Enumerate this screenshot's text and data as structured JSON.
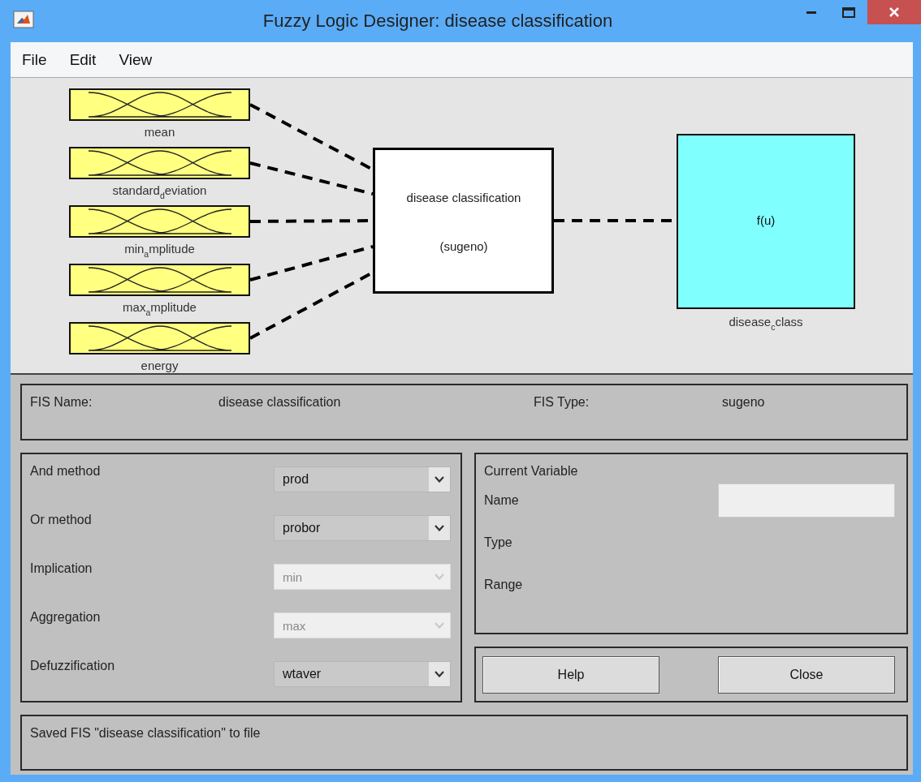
{
  "window": {
    "title": "Fuzzy Logic Designer: disease classification"
  },
  "menu": [
    "File",
    "Edit",
    "View"
  ],
  "diagram": {
    "inputs": [
      {
        "label": "mean"
      },
      {
        "label": "standard$_{d}$eviation"
      },
      {
        "label": "min$_{a}$mplitude"
      },
      {
        "label": "max$_{a}$mplitude"
      },
      {
        "label": "energy"
      }
    ],
    "rule_block": {
      "name": "disease classification",
      "type": "(sugeno)"
    },
    "output": {
      "function": "f(u)",
      "label": "disease$_{c}$class"
    }
  },
  "fis": {
    "name_label": "FIS Name:",
    "name": "disease classification",
    "type_label": "FIS Type:",
    "type": "sugeno"
  },
  "methods": [
    {
      "label": "And method",
      "value": "prod",
      "disabled": false
    },
    {
      "label": "Or method",
      "value": "probor",
      "disabled": false
    },
    {
      "label": "Implication",
      "value": "min",
      "disabled": true
    },
    {
      "label": "Aggregation",
      "value": "max",
      "disabled": true
    },
    {
      "label": "Defuzzification",
      "value": "wtaver",
      "disabled": false
    }
  ],
  "current_variable": {
    "title": "Current Variable",
    "fields": [
      {
        "label": "Name",
        "kind": "field"
      },
      {
        "label": "Type",
        "kind": "text"
      },
      {
        "label": "Range",
        "kind": "text"
      }
    ]
  },
  "buttons": [
    "Help",
    "Close"
  ],
  "status": "Saved FIS \"disease classification\" to file"
}
